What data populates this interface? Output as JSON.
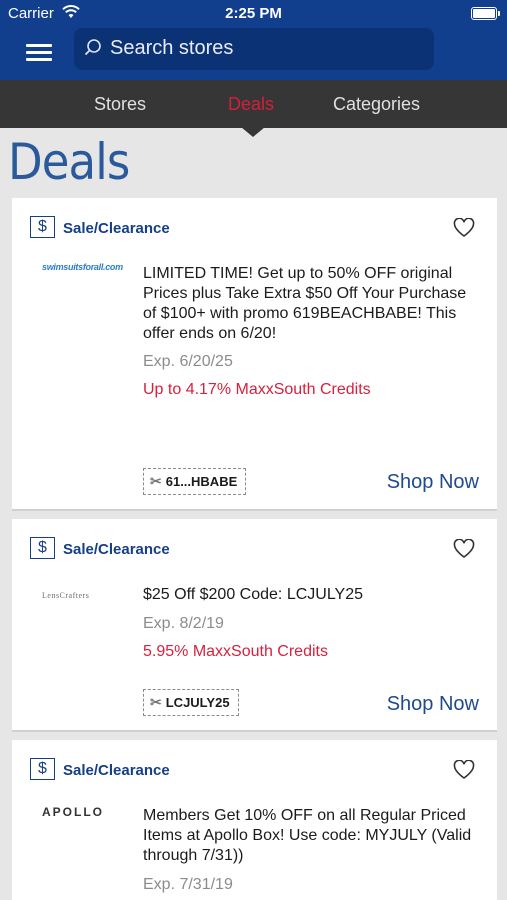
{
  "status_bar": {
    "carrier": "Carrier",
    "time": "2:25 PM"
  },
  "header": {
    "search_placeholder": "Search stores"
  },
  "tabs": [
    {
      "label": "Stores",
      "active": false
    },
    {
      "label": "Deals",
      "active": true
    },
    {
      "label": "Categories",
      "active": false
    }
  ],
  "page": {
    "title": "Deals"
  },
  "deals": [
    {
      "category": "Sale/Clearance",
      "store_logo": "swimsuitsforall.com",
      "description": "LIMITED TIME! Get up to 50% OFF original Prices plus Take Extra $50 Off Your Purchase of $100+ with promo 619BEACHBABE! This offer ends on 6/20!",
      "expiry": "Exp. 6/20/25",
      "credits": "Up to 4.17% MaxxSouth Credits",
      "code": "61...HBABE",
      "cta": "Shop Now"
    },
    {
      "category": "Sale/Clearance",
      "store_logo": "LensCrafters",
      "description": "$25 Off $200 Code: LCJULY25",
      "expiry": "Exp. 8/2/19",
      "credits": "5.95% MaxxSouth Credits",
      "code": "LCJULY25",
      "cta": "Shop Now"
    },
    {
      "category": "Sale/Clearance",
      "store_logo": "APOLLO",
      "description": "Members Get 10% OFF on all Regular Priced Items at Apollo Box! Use code: MYJULY (Valid through 7/31))",
      "expiry": "Exp. 7/31/19"
    }
  ],
  "colors": {
    "header_blue": "#123e8e",
    "tab_bar": "#363636",
    "active_tab": "#d41f3a",
    "credits_red": "#d6213e",
    "link_blue": "#1f4a8e"
  },
  "icons": [
    "wifi-icon",
    "battery-icon",
    "menu-icon",
    "search-icon",
    "dollar-icon",
    "heart-icon",
    "scissors-icon"
  ]
}
